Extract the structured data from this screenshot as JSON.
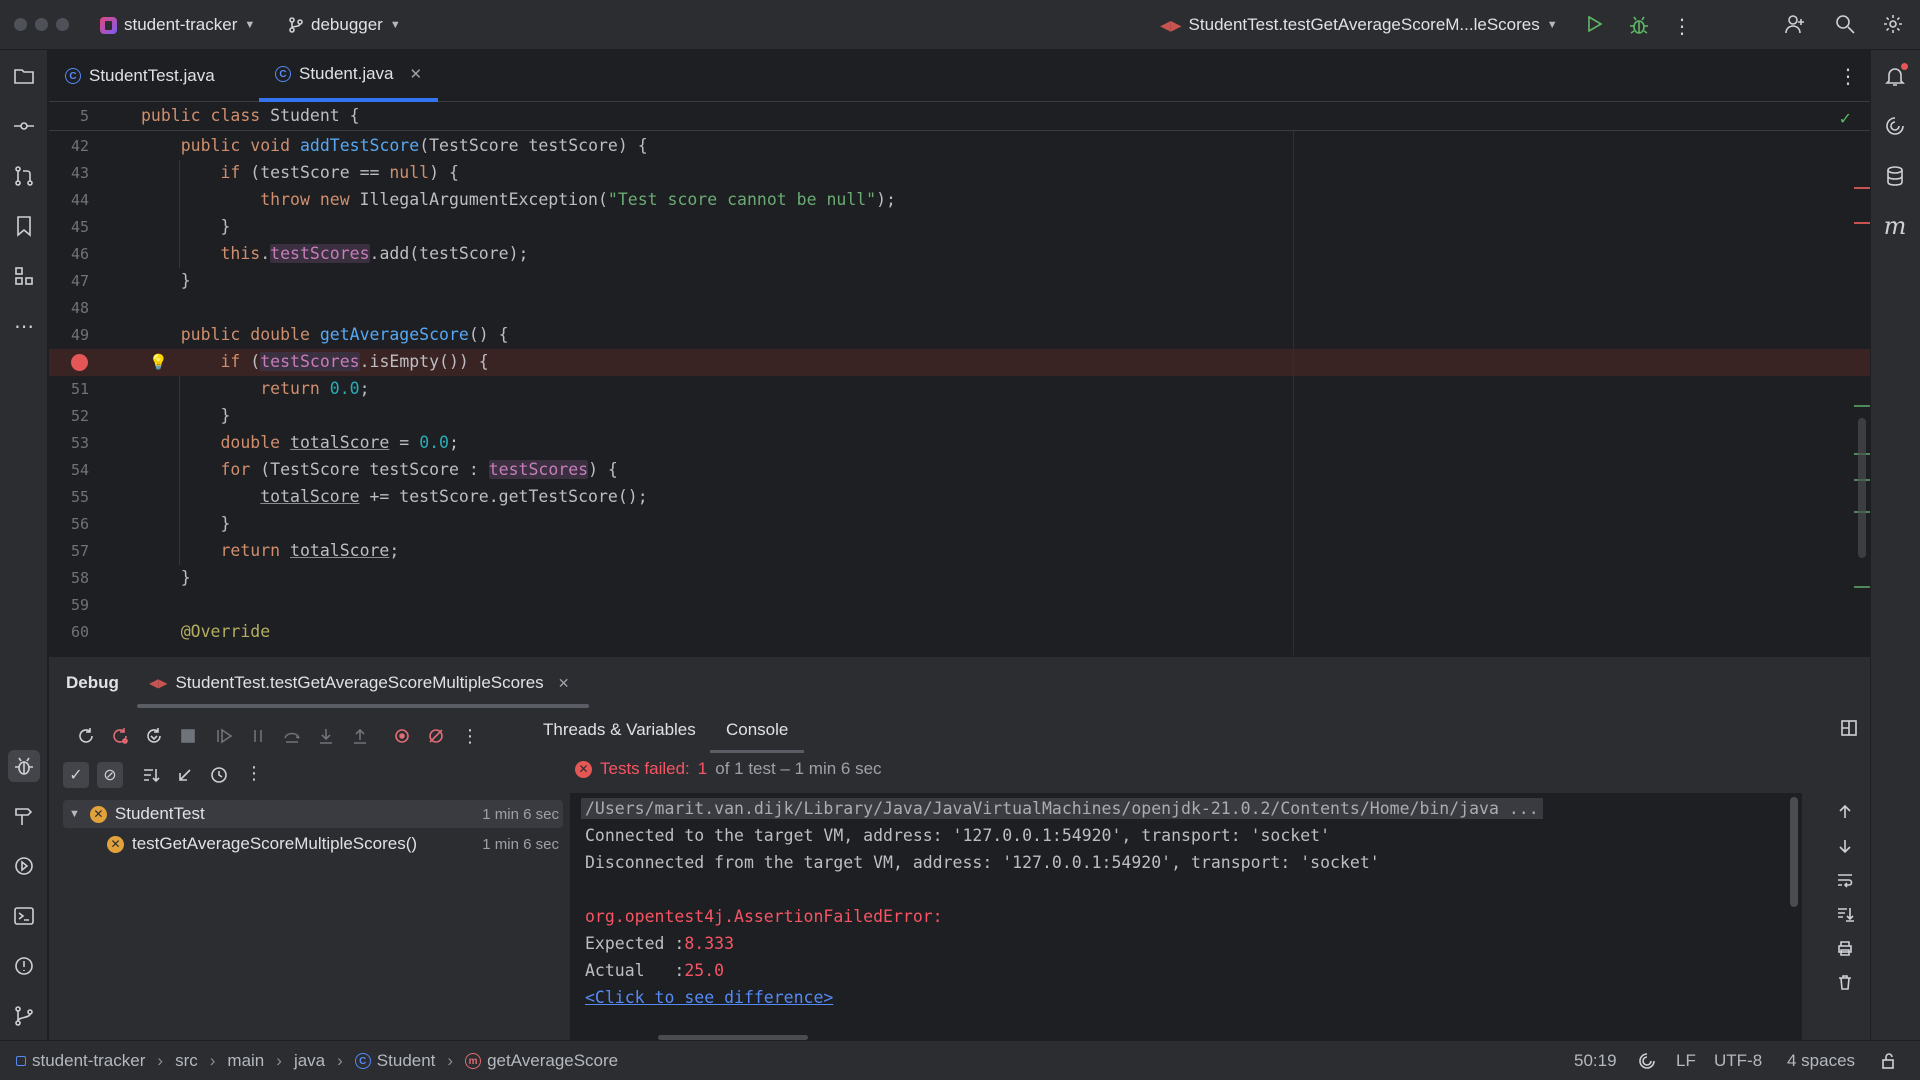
{
  "titlebar": {
    "project": "student-tracker",
    "branch": "debugger",
    "run_config": "StudentTest.testGetAverageScoreM...leScores"
  },
  "tabs": [
    {
      "label": "StudentTest.java",
      "active": false
    },
    {
      "label": "Student.java",
      "active": true
    }
  ],
  "editor": {
    "sticky": {
      "num": "5",
      "code": "public class Student {"
    },
    "lines": [
      {
        "num": "42",
        "code": "public void addTestScore(TestScore testScore) {"
      },
      {
        "num": "43",
        "code": "if (testScore == null) {"
      },
      {
        "num": "44",
        "code": "throw new IllegalArgumentException(\"Test score cannot be null\");"
      },
      {
        "num": "45",
        "code": "}"
      },
      {
        "num": "46",
        "code": "this.testScores.add(testScore);"
      },
      {
        "num": "47",
        "code": "}"
      },
      {
        "num": "48",
        "code": ""
      },
      {
        "num": "49",
        "code": "public double getAverageScore() {"
      },
      {
        "num": "50",
        "code": "if (testScores.isEmpty()) {"
      },
      {
        "num": "51",
        "code": "return 0.0;"
      },
      {
        "num": "52",
        "code": "}"
      },
      {
        "num": "53",
        "code": "double totalScore = 0.0;"
      },
      {
        "num": "54",
        "code": "for (TestScore testScore : testScores) {"
      },
      {
        "num": "55",
        "code": "totalScore += testScore.getTestScore();"
      },
      {
        "num": "56",
        "code": "}"
      },
      {
        "num": "57",
        "code": "return totalScore;"
      },
      {
        "num": "58",
        "code": "}"
      },
      {
        "num": "59",
        "code": ""
      },
      {
        "num": "60",
        "code": "@Override"
      }
    ],
    "breakpoint_line": "50"
  },
  "debug": {
    "title": "Debug",
    "session": "StudentTest.testGetAverageScoreMultipleScores",
    "subtabs": [
      "Threads & Variables",
      "Console"
    ],
    "active_subtab": "Console",
    "status": {
      "prefix": "Tests failed:",
      "count": "1",
      "suffix": "of 1 test – 1 min 6 sec"
    },
    "tree": [
      {
        "label": "StudentTest",
        "duration": "1 min 6 sec"
      },
      {
        "label": "testGetAverageScoreMultipleScores()",
        "duration": "1 min 6 sec"
      }
    ],
    "console": {
      "cmd": "/Users/marit.van.dijk/Library/Java/JavaVirtualMachines/openjdk-21.0.2/Contents/Home/bin/java ...",
      "connected": "Connected to the target VM, address: '127.0.0.1:54920', transport: 'socket'",
      "disconnected": "Disconnected from the target VM, address: '127.0.0.1:54920', transport: 'socket'",
      "error": "org.opentest4j.AssertionFailedError:",
      "expected_label": "Expected :",
      "expected_value": "8.333",
      "actual_label": "Actual   :",
      "actual_value": "25.0",
      "diff_link": "<Click to see difference>"
    }
  },
  "statusbar": {
    "breadcrumbs": [
      "student-tracker",
      "src",
      "main",
      "java",
      "Student",
      "getAverageScore"
    ],
    "position": "50:19",
    "line_sep": "LF",
    "encoding": "UTF-8",
    "indent": "4 spaces"
  },
  "colors": {
    "accent": "#3574f0",
    "error": "#f75464",
    "breakpoint": "#e55755",
    "warning": "#e2a23b"
  }
}
